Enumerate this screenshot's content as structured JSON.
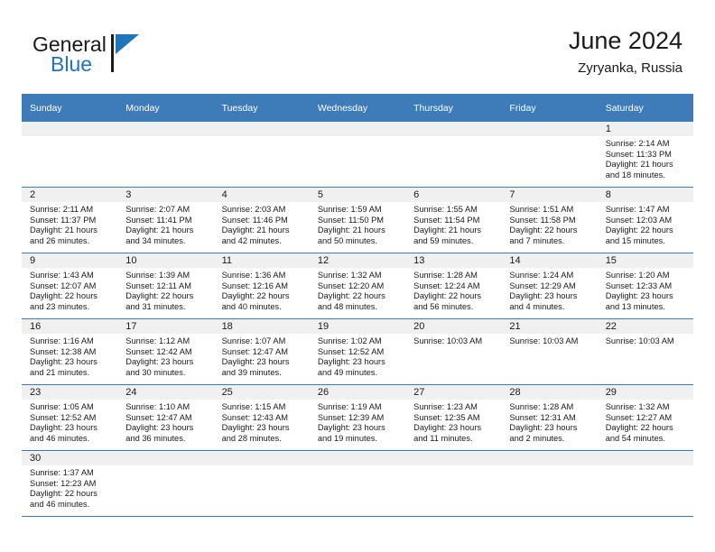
{
  "brand": {
    "name_part1": "General",
    "name_part2": "Blue",
    "logo_icon": "blue-triangle-flag",
    "color_blue": "#1F74BB"
  },
  "header": {
    "title": "June 2024",
    "subtitle": "Zyryanka, Russia"
  },
  "theme": {
    "header_blue": "#3E7CB9",
    "daynum_band": "#F0F0F0",
    "text": "#1a1a1a"
  },
  "calendar": {
    "weekday_headers": [
      "Sunday",
      "Monday",
      "Tuesday",
      "Wednesday",
      "Thursday",
      "Friday",
      "Saturday"
    ],
    "weeks": [
      [
        {
          "day": "",
          "lines": []
        },
        {
          "day": "",
          "lines": []
        },
        {
          "day": "",
          "lines": []
        },
        {
          "day": "",
          "lines": []
        },
        {
          "day": "",
          "lines": []
        },
        {
          "day": "",
          "lines": []
        },
        {
          "day": "1",
          "lines": [
            "Sunrise: 2:14 AM",
            "Sunset: 11:33 PM",
            "Daylight: 21 hours",
            "and 18 minutes."
          ]
        }
      ],
      [
        {
          "day": "2",
          "lines": [
            "Sunrise: 2:11 AM",
            "Sunset: 11:37 PM",
            "Daylight: 21 hours",
            "and 26 minutes."
          ]
        },
        {
          "day": "3",
          "lines": [
            "Sunrise: 2:07 AM",
            "Sunset: 11:41 PM",
            "Daylight: 21 hours",
            "and 34 minutes."
          ]
        },
        {
          "day": "4",
          "lines": [
            "Sunrise: 2:03 AM",
            "Sunset: 11:46 PM",
            "Daylight: 21 hours",
            "and 42 minutes."
          ]
        },
        {
          "day": "5",
          "lines": [
            "Sunrise: 1:59 AM",
            "Sunset: 11:50 PM",
            "Daylight: 21 hours",
            "and 50 minutes."
          ]
        },
        {
          "day": "6",
          "lines": [
            "Sunrise: 1:55 AM",
            "Sunset: 11:54 PM",
            "Daylight: 21 hours",
            "and 59 minutes."
          ]
        },
        {
          "day": "7",
          "lines": [
            "Sunrise: 1:51 AM",
            "Sunset: 11:58 PM",
            "Daylight: 22 hours",
            "and 7 minutes."
          ]
        },
        {
          "day": "8",
          "lines": [
            "Sunrise: 1:47 AM",
            "Sunset: 12:03 AM",
            "Daylight: 22 hours",
            "and 15 minutes."
          ]
        }
      ],
      [
        {
          "day": "9",
          "lines": [
            "Sunrise: 1:43 AM",
            "Sunset: 12:07 AM",
            "Daylight: 22 hours",
            "and 23 minutes."
          ]
        },
        {
          "day": "10",
          "lines": [
            "Sunrise: 1:39 AM",
            "Sunset: 12:11 AM",
            "Daylight: 22 hours",
            "and 31 minutes."
          ]
        },
        {
          "day": "11",
          "lines": [
            "Sunrise: 1:36 AM",
            "Sunset: 12:16 AM",
            "Daylight: 22 hours",
            "and 40 minutes."
          ]
        },
        {
          "day": "12",
          "lines": [
            "Sunrise: 1:32 AM",
            "Sunset: 12:20 AM",
            "Daylight: 22 hours",
            "and 48 minutes."
          ]
        },
        {
          "day": "13",
          "lines": [
            "Sunrise: 1:28 AM",
            "Sunset: 12:24 AM",
            "Daylight: 22 hours",
            "and 56 minutes."
          ]
        },
        {
          "day": "14",
          "lines": [
            "Sunrise: 1:24 AM",
            "Sunset: 12:29 AM",
            "Daylight: 23 hours",
            "and 4 minutes."
          ]
        },
        {
          "day": "15",
          "lines": [
            "Sunrise: 1:20 AM",
            "Sunset: 12:33 AM",
            "Daylight: 23 hours",
            "and 13 minutes."
          ]
        }
      ],
      [
        {
          "day": "16",
          "lines": [
            "Sunrise: 1:16 AM",
            "Sunset: 12:38 AM",
            "Daylight: 23 hours",
            "and 21 minutes."
          ]
        },
        {
          "day": "17",
          "lines": [
            "Sunrise: 1:12 AM",
            "Sunset: 12:42 AM",
            "Daylight: 23 hours",
            "and 30 minutes."
          ]
        },
        {
          "day": "18",
          "lines": [
            "Sunrise: 1:07 AM",
            "Sunset: 12:47 AM",
            "Daylight: 23 hours",
            "and 39 minutes."
          ]
        },
        {
          "day": "19",
          "lines": [
            "Sunrise: 1:02 AM",
            "Sunset: 12:52 AM",
            "Daylight: 23 hours",
            "and 49 minutes."
          ]
        },
        {
          "day": "20",
          "lines": [
            "Sunrise: 10:03 AM"
          ]
        },
        {
          "day": "21",
          "lines": [
            "Sunrise: 10:03 AM"
          ]
        },
        {
          "day": "22",
          "lines": [
            "Sunrise: 10:03 AM"
          ]
        }
      ],
      [
        {
          "day": "23",
          "lines": [
            "Sunrise: 1:05 AM",
            "Sunset: 12:52 AM",
            "Daylight: 23 hours",
            "and 46 minutes."
          ]
        },
        {
          "day": "24",
          "lines": [
            "Sunrise: 1:10 AM",
            "Sunset: 12:47 AM",
            "Daylight: 23 hours",
            "and 36 minutes."
          ]
        },
        {
          "day": "25",
          "lines": [
            "Sunrise: 1:15 AM",
            "Sunset: 12:43 AM",
            "Daylight: 23 hours",
            "and 28 minutes."
          ]
        },
        {
          "day": "26",
          "lines": [
            "Sunrise: 1:19 AM",
            "Sunset: 12:39 AM",
            "Daylight: 23 hours",
            "and 19 minutes."
          ]
        },
        {
          "day": "27",
          "lines": [
            "Sunrise: 1:23 AM",
            "Sunset: 12:35 AM",
            "Daylight: 23 hours",
            "and 11 minutes."
          ]
        },
        {
          "day": "28",
          "lines": [
            "Sunrise: 1:28 AM",
            "Sunset: 12:31 AM",
            "Daylight: 23 hours",
            "and 2 minutes."
          ]
        },
        {
          "day": "29",
          "lines": [
            "Sunrise: 1:32 AM",
            "Sunset: 12:27 AM",
            "Daylight: 22 hours",
            "and 54 minutes."
          ]
        }
      ],
      [
        {
          "day": "30",
          "lines": [
            "Sunrise: 1:37 AM",
            "Sunset: 12:23 AM",
            "Daylight: 22 hours",
            "and 46 minutes."
          ]
        },
        {
          "day": "",
          "lines": []
        },
        {
          "day": "",
          "lines": []
        },
        {
          "day": "",
          "lines": []
        },
        {
          "day": "",
          "lines": []
        },
        {
          "day": "",
          "lines": []
        },
        {
          "day": "",
          "lines": []
        }
      ]
    ]
  }
}
